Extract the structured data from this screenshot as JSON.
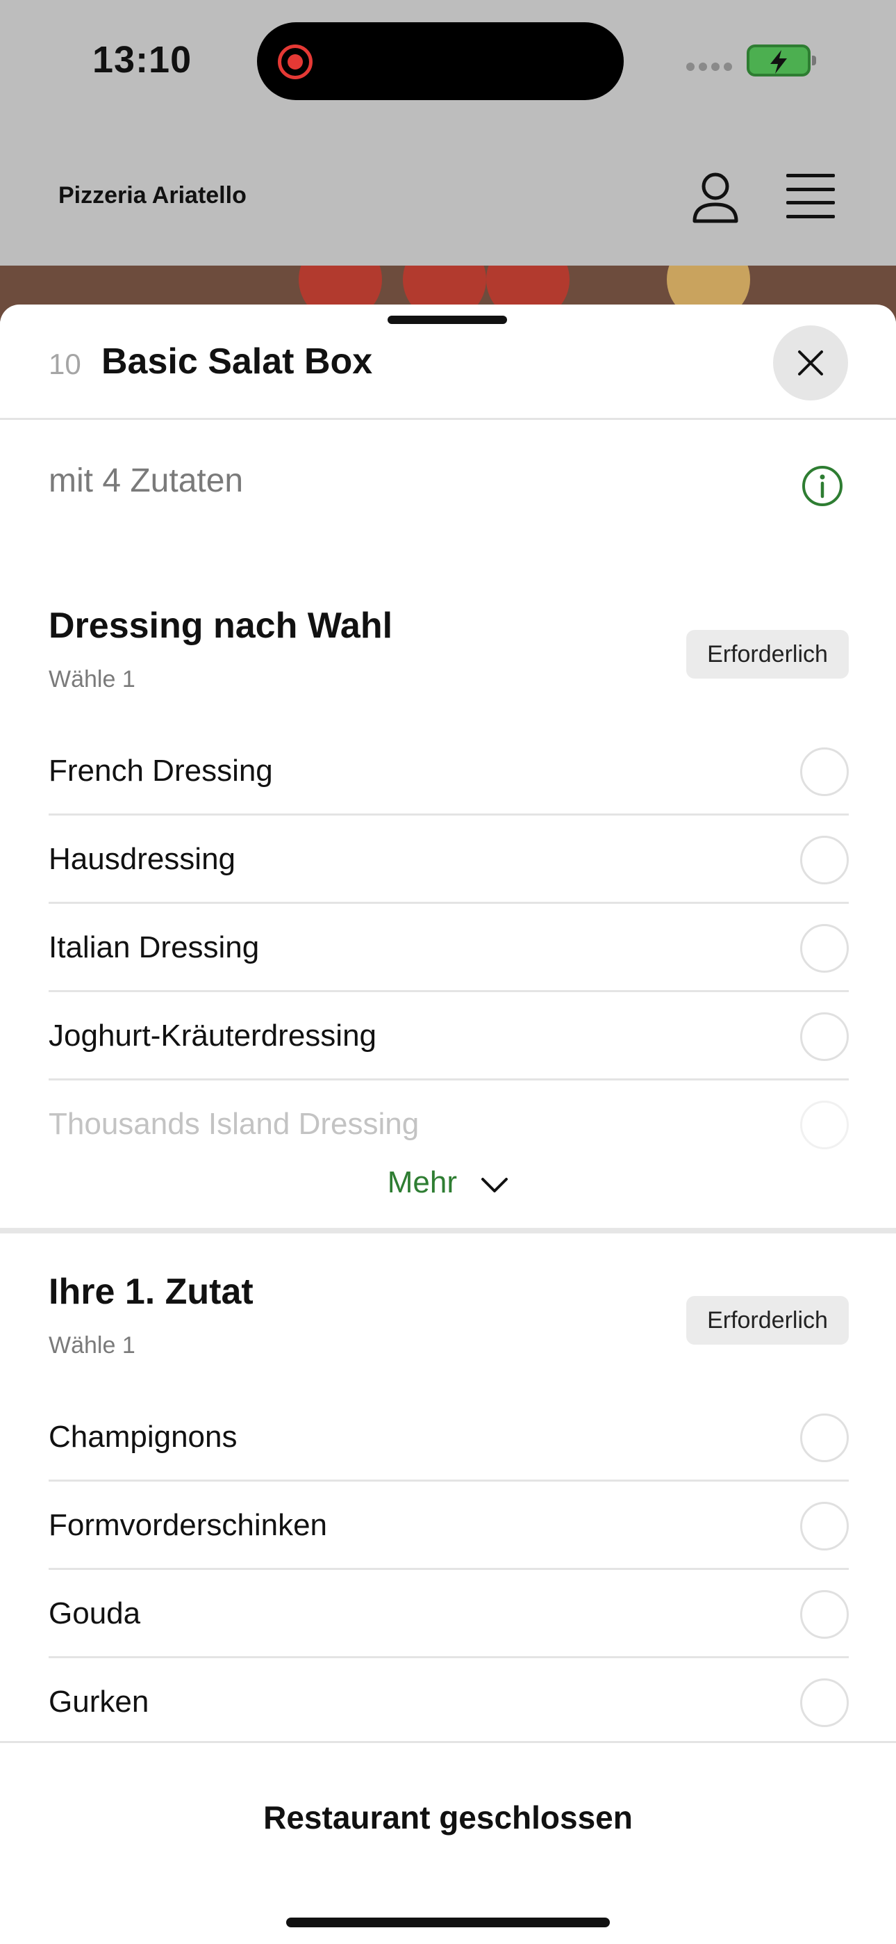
{
  "status_bar": {
    "time": "13:10"
  },
  "app": {
    "brand": "Pizzeria Ariatello"
  },
  "sheet": {
    "item_number": "10",
    "item_title": "Basic Salat Box",
    "description": "mit 4 Zutaten"
  },
  "sections": [
    {
      "title": "Dressing nach Wahl",
      "subtitle": "Wähle 1",
      "badge": "Erforderlich",
      "options": [
        "French Dressing",
        "Hausdressing",
        "Italian Dressing",
        "Joghurt-Kräuterdressing",
        "Thousands Island Dressing"
      ],
      "more_label": "Mehr"
    },
    {
      "title": "Ihre 1. Zutat",
      "subtitle": "Wähle 1",
      "badge": "Erforderlich",
      "options": [
        "Champignons",
        "Formvorderschinken",
        "Gouda",
        "Gurken"
      ]
    }
  ],
  "footer": {
    "status": "Restaurant geschlossen"
  },
  "colors": {
    "accent": "#2e7d32",
    "badge_bg": "#ebebeb"
  }
}
